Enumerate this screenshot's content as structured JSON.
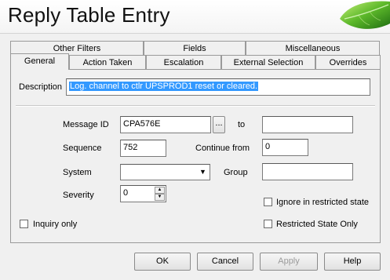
{
  "window": {
    "title": "Reply Table Entry"
  },
  "tabs_row1": [
    "Other Filters",
    "Fields",
    "Miscellaneous"
  ],
  "tabs_row2": [
    "General",
    "Action Taken",
    "Escalation",
    "External Selection",
    "Overrides"
  ],
  "active_tab": "General",
  "form": {
    "description_label": "Description",
    "description_value": "Log. channel to ctlr UPSPROD1 reset or cleared.",
    "message_id_label": "Message ID",
    "message_id_value": "CPA576E",
    "browse_label": "...",
    "to_label": "to",
    "to_value": "",
    "sequence_label": "Sequence",
    "sequence_value": "752",
    "continue_from_label": "Continue from",
    "continue_from_value": "0",
    "system_label": "System",
    "system_value": "",
    "group_label": "Group",
    "group_value": "",
    "severity_label": "Severity",
    "severity_value": "0",
    "ignore_restricted_label": "Ignore in restricted state",
    "ignore_restricted_checked": false,
    "inquiry_only_label": "Inquiry only",
    "inquiry_only_checked": false,
    "restricted_only_label": "Restricted State Only",
    "restricted_only_checked": false
  },
  "buttons": {
    "ok": "OK",
    "cancel": "Cancel",
    "apply": "Apply",
    "help": "Help"
  },
  "colors": {
    "selection": "#3399ff",
    "window_bg": "#f0f0f0"
  }
}
